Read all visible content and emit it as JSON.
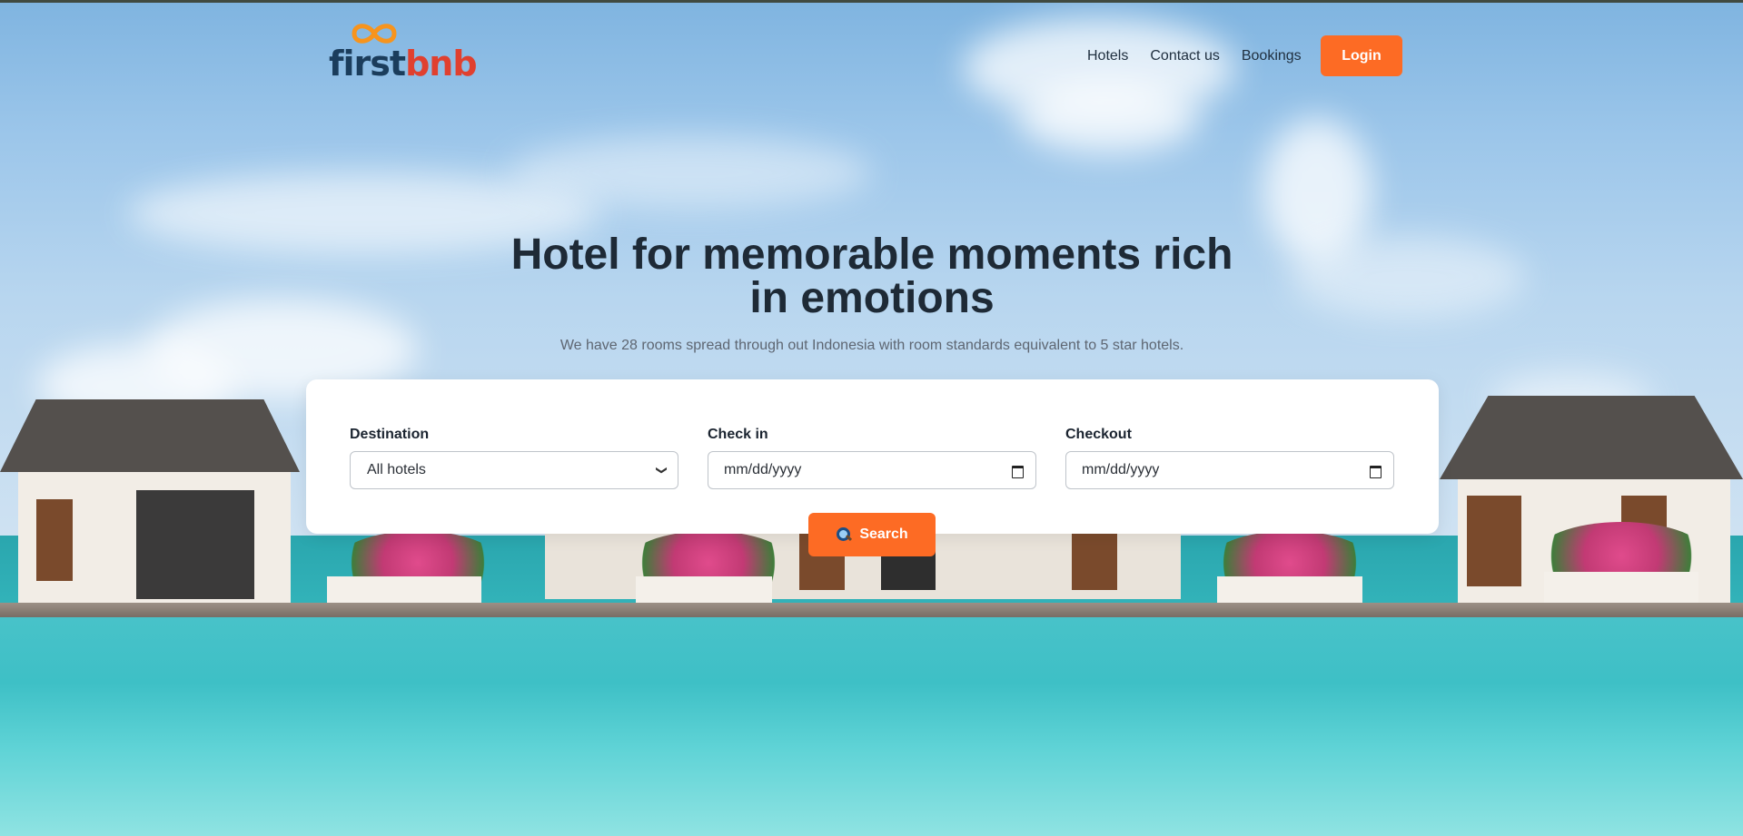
{
  "brand": {
    "logo_part1": "first",
    "logo_part2": "bnb"
  },
  "nav": {
    "items": [
      "Hotels",
      "Contact us",
      "Bookings"
    ],
    "login_label": "Login"
  },
  "hero": {
    "title": "Hotel for memorable moments rich in emotions",
    "subtitle": "We have 28 rooms spread through out Indonesia with room standards equivalent to 5 star hotels."
  },
  "search": {
    "destination_label": "Destination",
    "destination_value": "All hotels",
    "checkin_label": "Check in",
    "checkin_placeholder": "mm/dd/yyyy",
    "checkout_label": "Checkout",
    "checkout_placeholder": "mm/dd/yyyy",
    "search_label": "Search"
  },
  "colors": {
    "accent": "#fd6b24",
    "logo_dark": "#1b3d5c",
    "logo_red": "#e0402f"
  },
  "icons": {
    "logo_mark": "infinity-logo-icon",
    "search": "magnifier-icon",
    "calendar": "calendar-icon",
    "dropdown": "chevron-down-icon"
  }
}
